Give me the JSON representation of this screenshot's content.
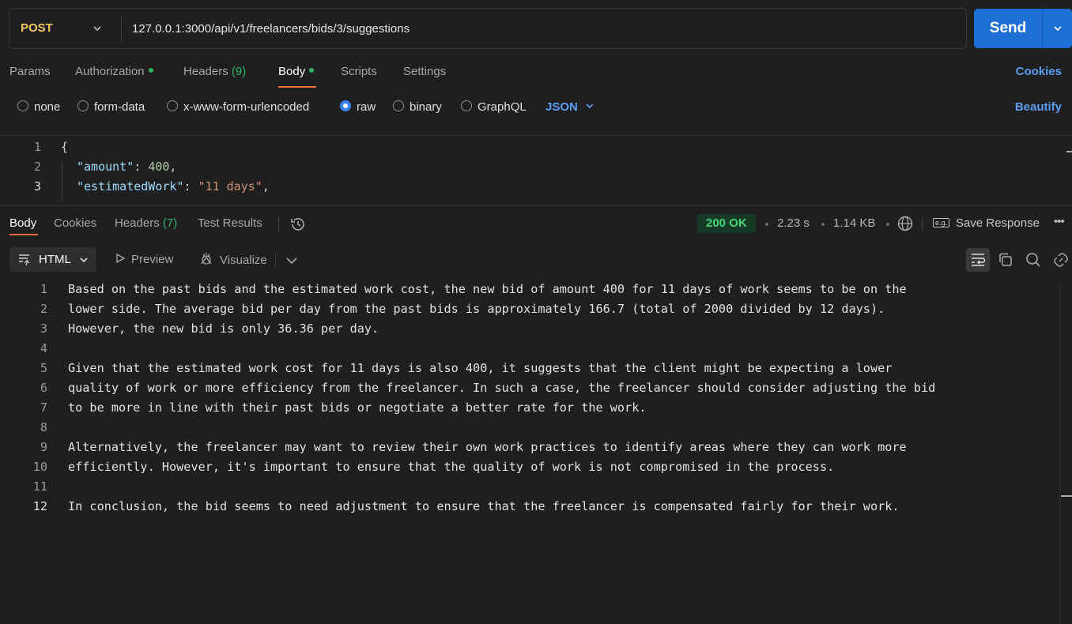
{
  "request": {
    "method": "POST",
    "url": "127.0.0.1:3000/api/v1/freelancers/bids/3/suggestions",
    "send_label": "Send"
  },
  "request_tabs": {
    "params": "Params",
    "authorization": "Authorization",
    "headers": "Headers",
    "headers_count": "(9)",
    "body": "Body",
    "scripts": "Scripts",
    "settings": "Settings",
    "cookies": "Cookies"
  },
  "body_types": {
    "none": "none",
    "form_data": "form-data",
    "urlencoded": "x-www-form-urlencoded",
    "raw": "raw",
    "binary": "binary",
    "graphql": "GraphQL",
    "selected": "raw",
    "format": "JSON",
    "beautify": "Beautify"
  },
  "request_body": {
    "line_numbers": [
      "1",
      "2",
      "3"
    ],
    "open_brace": "{",
    "amount_key": "\"amount\"",
    "amount_val": "400",
    "work_key": "\"estimatedWork\"",
    "work_val": "\"11 days\"",
    "colon": ": ",
    "comma": ","
  },
  "response_tabs": {
    "body": "Body",
    "cookies": "Cookies",
    "headers": "Headers",
    "headers_count": "(7)",
    "test_results": "Test Results",
    "status": "200 OK",
    "time": "2.23 s",
    "size": "1.14 KB",
    "save_response": "Save Response",
    "save_icon_text": "e.g."
  },
  "response_toolbar": {
    "format": "HTML",
    "preview": "Preview",
    "visualize": "Visualize"
  },
  "response_body": {
    "lines": [
      {
        "n": "1",
        "text": "Based on the past bids and the estimated work cost, the new bid of amount 400 for 11 days of work seems to be on the"
      },
      {
        "n": "2",
        "text": "lower side. The average bid per day from the past bids is approximately 166.7 (total of 2000 divided by 12 days)."
      },
      {
        "n": "3",
        "text": "However, the new bid is only 36.36 per day."
      },
      {
        "n": "4",
        "text": ""
      },
      {
        "n": "5",
        "text": "Given that the estimated work cost for 11 days is also 400, it suggests that the client might be expecting a lower"
      },
      {
        "n": "6",
        "text": "quality of work or more efficiency from the freelancer. In such a case, the freelancer should consider adjusting the bid"
      },
      {
        "n": "7",
        "text": "to be more in line with their past bids or negotiate a better rate for the work."
      },
      {
        "n": "8",
        "text": ""
      },
      {
        "n": "9",
        "text": "Alternatively, the freelancer may want to review their own work practices to identify areas where they can work more"
      },
      {
        "n": "10",
        "text": "efficiently. However, it's important to ensure that the quality of work is not compromised in the process."
      },
      {
        "n": "11",
        "text": ""
      },
      {
        "n": "12",
        "text": "In conclusion, the bid seems to need adjustment to ensure that the freelancer is compensated fairly for their work."
      }
    ]
  },
  "colors": {
    "accent": "#1d6fd6",
    "method": "#f8c66a",
    "status_ok": "#47d27a",
    "tab_underline": "#f26b3a",
    "link": "#5a9ff5"
  }
}
